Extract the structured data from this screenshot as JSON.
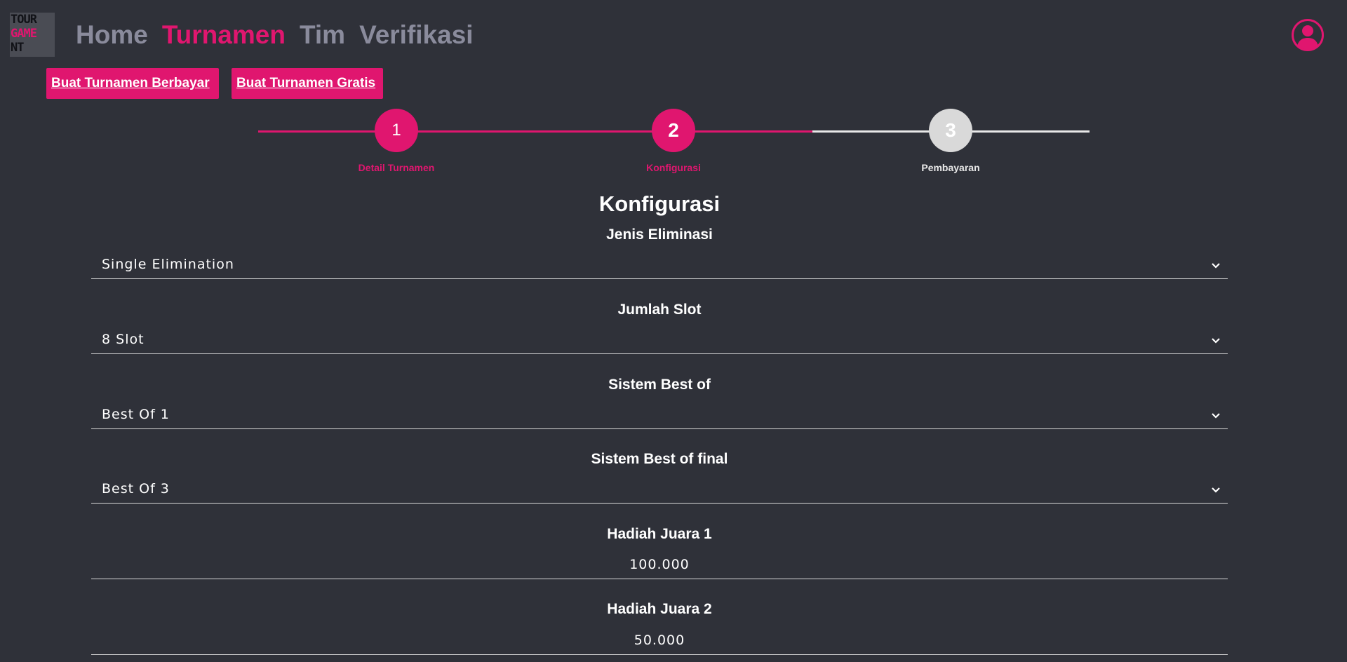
{
  "logo": {
    "line1": "TOUR",
    "line2": "GAME",
    "line3": "NT"
  },
  "nav": {
    "home": "Home",
    "turnamen": "Turnamen",
    "tim": "Tim",
    "verifikasi": "Verifikasi",
    "active": "Turnamen"
  },
  "actions": {
    "paid": "Buat Turnamen Berbayar",
    "free": "Buat Turnamen Gratis"
  },
  "stepper": {
    "current_step": 2,
    "steps": [
      {
        "number": "1",
        "label": "Detail Turnamen"
      },
      {
        "number": "2",
        "label": "Konfigurasi"
      },
      {
        "number": "3",
        "label": "Pembayaran"
      }
    ]
  },
  "form": {
    "title": "Konfigurasi",
    "elimination": {
      "label": "Jenis Eliminasi",
      "value": "Single Elimination"
    },
    "slots": {
      "label": "Jumlah Slot",
      "value": "8 Slot"
    },
    "best_of": {
      "label": "Sistem Best of",
      "value": "Best Of 1"
    },
    "best_of_final": {
      "label": "Sistem Best of final",
      "value": "Best Of 3"
    },
    "prize1": {
      "label": "Hadiah Juara 1",
      "value": "100.000"
    },
    "prize2": {
      "label": "Hadiah Juara 2",
      "value": "50.000"
    }
  },
  "colors": {
    "accent": "#e0166f",
    "background": "#2f3139",
    "nav_inactive": "#8a8b9c",
    "step_pending": "#d9d9d9"
  },
  "icons": {
    "profile": "user-circle-icon",
    "dropdown": "chevron-down-icon"
  }
}
